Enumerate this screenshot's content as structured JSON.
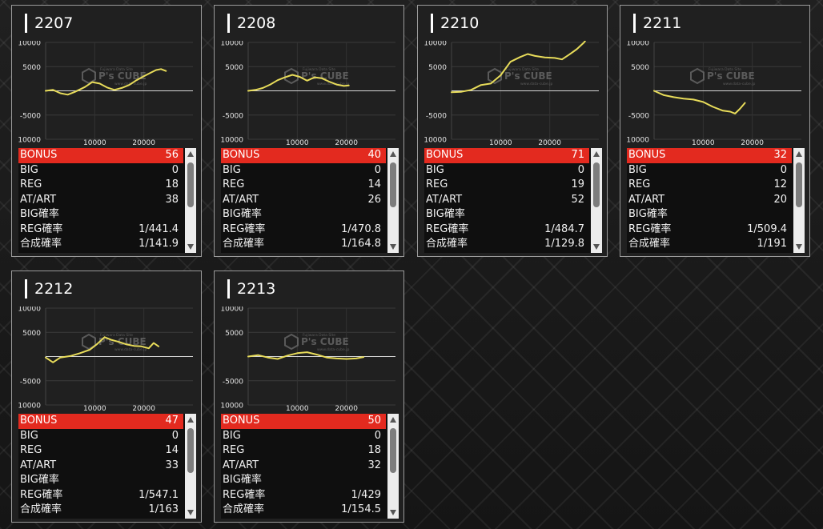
{
  "logo": {
    "main": "P's CUBE",
    "tagline": "Fujiwara Data Site",
    "sub": "www.data-cube.jp"
  },
  "colors": {
    "bonus_bar": "#e32a1f",
    "line": "#e8dc5a",
    "panel": "#202020"
  },
  "machines": [
    {
      "id": "2207",
      "stats": {
        "bonus_label": "BONUS",
        "bonus": "56",
        "big_label": "BIG",
        "big": "0",
        "reg_label": "REG",
        "reg": "18",
        "at_label": "AT/ART",
        "at": "38",
        "big_rate_label": "BIG確率",
        "big_rate": "",
        "reg_rate_label": "REG確率",
        "reg_rate": "1/441.4",
        "total_rate_label": "合成確率",
        "total_rate": "1/141.9"
      },
      "chart_data": {
        "type": "line",
        "yticks": [
          "10000",
          "5000",
          "-5000",
          "-10000"
        ],
        "xticks": [
          "10000",
          "20000"
        ],
        "xlim": [
          0,
          30000
        ],
        "ylim": [
          -10000,
          10000
        ],
        "points": [
          [
            0,
            0
          ],
          [
            1500,
            200
          ],
          [
            3000,
            -500
          ],
          [
            4500,
            -800
          ],
          [
            6000,
            -200
          ],
          [
            8000,
            800
          ],
          [
            9500,
            1800
          ],
          [
            11000,
            1500
          ],
          [
            12500,
            700
          ],
          [
            14000,
            200
          ],
          [
            15500,
            600
          ],
          [
            17000,
            1200
          ],
          [
            18500,
            2200
          ],
          [
            20000,
            3000
          ],
          [
            21500,
            3800
          ],
          [
            22500,
            4300
          ],
          [
            23500,
            4500
          ],
          [
            24500,
            4100
          ]
        ]
      }
    },
    {
      "id": "2208",
      "stats": {
        "bonus_label": "BONUS",
        "bonus": "40",
        "big_label": "BIG",
        "big": "0",
        "reg_label": "REG",
        "reg": "14",
        "at_label": "AT/ART",
        "at": "26",
        "big_rate_label": "BIG確率",
        "big_rate": "",
        "reg_rate_label": "REG確率",
        "reg_rate": "1/470.8",
        "total_rate_label": "合成確率",
        "total_rate": "1/164.8"
      },
      "chart_data": {
        "type": "line",
        "yticks": [
          "10000",
          "5000",
          "-5000",
          "-10000"
        ],
        "xticks": [
          "10000",
          "20000"
        ],
        "xlim": [
          0,
          30000
        ],
        "ylim": [
          -10000,
          10000
        ],
        "points": [
          [
            0,
            0
          ],
          [
            1500,
            200
          ],
          [
            3000,
            600
          ],
          [
            4500,
            1300
          ],
          [
            6000,
            2200
          ],
          [
            7500,
            2800
          ],
          [
            9000,
            3300
          ],
          [
            10500,
            2900
          ],
          [
            12000,
            2100
          ],
          [
            13500,
            2800
          ],
          [
            15000,
            2600
          ],
          [
            16500,
            1900
          ],
          [
            18000,
            1300
          ],
          [
            19500,
            1000
          ],
          [
            20500,
            1100
          ]
        ]
      }
    },
    {
      "id": "2210",
      "stats": {
        "bonus_label": "BONUS",
        "bonus": "71",
        "big_label": "BIG",
        "big": "0",
        "reg_label": "REG",
        "reg": "19",
        "at_label": "AT/ART",
        "at": "52",
        "big_rate_label": "BIG確率",
        "big_rate": "",
        "reg_rate_label": "REG確率",
        "reg_rate": "1/484.7",
        "total_rate_label": "合成確率",
        "total_rate": "1/129.8"
      },
      "chart_data": {
        "type": "line",
        "yticks": [
          "10000",
          "5000",
          "-5000",
          "-10000"
        ],
        "xticks": [
          "10000",
          "20000"
        ],
        "xlim": [
          0,
          30000
        ],
        "ylim": [
          -10000,
          10000
        ],
        "points": [
          [
            0,
            -300
          ],
          [
            2000,
            -200
          ],
          [
            4000,
            200
          ],
          [
            6000,
            1200
          ],
          [
            8000,
            1500
          ],
          [
            10000,
            3200
          ],
          [
            12000,
            6000
          ],
          [
            14000,
            7000
          ],
          [
            15500,
            7600
          ],
          [
            17000,
            7200
          ],
          [
            19000,
            6900
          ],
          [
            21000,
            6800
          ],
          [
            22500,
            6500
          ],
          [
            24000,
            7500
          ],
          [
            25500,
            8600
          ],
          [
            27000,
            10000
          ],
          [
            28000,
            11500
          ]
        ]
      }
    },
    {
      "id": "2211",
      "stats": {
        "bonus_label": "BONUS",
        "bonus": "32",
        "big_label": "BIG",
        "big": "0",
        "reg_label": "REG",
        "reg": "12",
        "at_label": "AT/ART",
        "at": "20",
        "big_rate_label": "BIG確率",
        "big_rate": "",
        "reg_rate_label": "REG確率",
        "reg_rate": "1/509.4",
        "total_rate_label": "合成確率",
        "total_rate": "1/191"
      },
      "chart_data": {
        "type": "line",
        "yticks": [
          "10000",
          "5000",
          "-5000",
          "-10000"
        ],
        "xticks": [
          "10000",
          "20000"
        ],
        "xlim": [
          0,
          30000
        ],
        "ylim": [
          -10000,
          10000
        ],
        "points": [
          [
            0,
            0
          ],
          [
            2000,
            -900
          ],
          [
            4000,
            -1300
          ],
          [
            6000,
            -1600
          ],
          [
            8000,
            -1800
          ],
          [
            10000,
            -2300
          ],
          [
            12000,
            -3300
          ],
          [
            14000,
            -4100
          ],
          [
            15500,
            -4300
          ],
          [
            16500,
            -4700
          ],
          [
            17500,
            -3700
          ],
          [
            18500,
            -2500
          ]
        ]
      }
    },
    {
      "id": "2212",
      "stats": {
        "bonus_label": "BONUS",
        "bonus": "47",
        "big_label": "BIG",
        "big": "0",
        "reg_label": "REG",
        "reg": "14",
        "at_label": "AT/ART",
        "at": "33",
        "big_rate_label": "BIG確率",
        "big_rate": "",
        "reg_rate_label": "REG確率",
        "reg_rate": "1/547.1",
        "total_rate_label": "合成確率",
        "total_rate": "1/163"
      },
      "chart_data": {
        "type": "line",
        "yticks": [
          "10000",
          "5000",
          "-5000",
          "-10000"
        ],
        "xticks": [
          "10000",
          "20000"
        ],
        "xlim": [
          0,
          30000
        ],
        "ylim": [
          -10000,
          10000
        ],
        "points": [
          [
            0,
            -200
          ],
          [
            1500,
            -1200
          ],
          [
            3000,
            -200
          ],
          [
            5000,
            100
          ],
          [
            7000,
            700
          ],
          [
            9000,
            1400
          ],
          [
            10500,
            2600
          ],
          [
            12000,
            4000
          ],
          [
            13500,
            3400
          ],
          [
            15000,
            3000
          ],
          [
            16500,
            2500
          ],
          [
            18000,
            2200
          ],
          [
            19500,
            2100
          ],
          [
            21000,
            1700
          ],
          [
            22000,
            2800
          ],
          [
            23000,
            2100
          ]
        ]
      }
    },
    {
      "id": "2213",
      "stats": {
        "bonus_label": "BONUS",
        "bonus": "50",
        "big_label": "BIG",
        "big": "0",
        "reg_label": "REG",
        "reg": "18",
        "at_label": "AT/ART",
        "at": "32",
        "big_rate_label": "BIG確率",
        "big_rate": "",
        "reg_rate_label": "REG確率",
        "reg_rate": "1/429",
        "total_rate_label": "合成確率",
        "total_rate": "1/154.5"
      },
      "chart_data": {
        "type": "line",
        "yticks": [
          "10000",
          "5000",
          "-5000",
          "-10000"
        ],
        "xticks": [
          "10000",
          "20000"
        ],
        "xlim": [
          0,
          30000
        ],
        "ylim": [
          -10000,
          10000
        ],
        "points": [
          [
            0,
            0
          ],
          [
            2000,
            300
          ],
          [
            4000,
            -200
          ],
          [
            6000,
            -500
          ],
          [
            8000,
            200
          ],
          [
            10000,
            700
          ],
          [
            12000,
            900
          ],
          [
            14000,
            400
          ],
          [
            16000,
            -200
          ],
          [
            18000,
            -400
          ],
          [
            20000,
            -500
          ],
          [
            22000,
            -400
          ],
          [
            23500,
            -100
          ]
        ]
      }
    }
  ]
}
